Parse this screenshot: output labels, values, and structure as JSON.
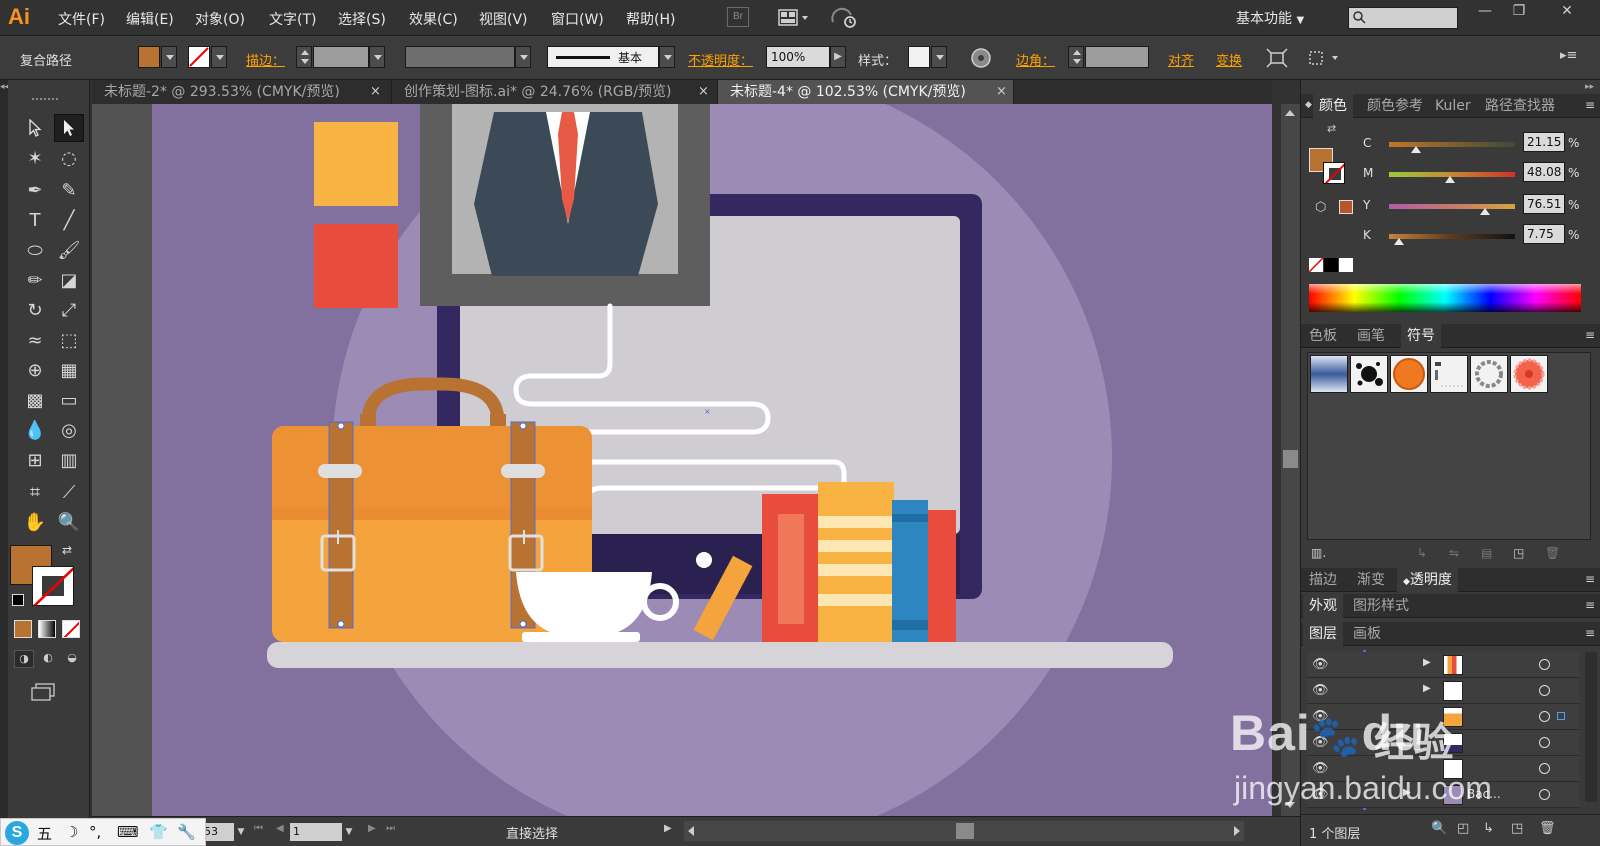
{
  "app": {
    "logo": "Ai"
  },
  "menu": {
    "items": [
      "文件(F)",
      "编辑(E)",
      "对象(O)",
      "文字(T)",
      "选择(S)",
      "效果(C)",
      "视图(V)",
      "窗口(W)",
      "帮助(H)"
    ],
    "bridge": "Br",
    "workspace": "基本功能",
    "window_min": "—",
    "window_restore": "❐",
    "window_close": "✕"
  },
  "control_bar": {
    "selection_type": "复合路径",
    "fill_color": "#b87333",
    "stroke_label": "描边：",
    "stroke_profile": "基本",
    "opacity_label": "不透明度：",
    "opacity_value": "100%",
    "style_label": "样式：",
    "corner_label": "边角：",
    "align_label": "对齐",
    "transform_label": "变换"
  },
  "tabs": [
    {
      "label": "未标题-2* @ 293.53% (CMYK/预览)",
      "close": "×",
      "active": false
    },
    {
      "label": "创作策划-图标.ai* @ 24.76% (RGB/预览)",
      "close": "×",
      "active": false
    },
    {
      "label": "未标题-4* @ 102.53% (CMYK/预览)",
      "close": "×",
      "active": true
    }
  ],
  "colors": {
    "canvas_bg": "#82719f",
    "circle": "#9b8bb5",
    "monitor_frame": "#332860",
    "monitor_screen": "#cfcdd1",
    "bag_body": "#f4a33d",
    "bag_lid": "#ec9235",
    "bag_handle": "#b87333",
    "strap": "#b87333",
    "shelf": "#d6d4d8",
    "accent_orange": "#f9b343",
    "accent_red": "#e74c3c",
    "book_blue": "#2e86c1",
    "suit": "#3c4a57"
  },
  "color_panel": {
    "tabs": [
      "颜色",
      "颜色参考",
      "Kuler",
      "路径查找器"
    ],
    "channels": [
      {
        "name": "C",
        "value": "21.15",
        "pct": 21.15
      },
      {
        "name": "M",
        "value": "48.08",
        "pct": 48.08
      },
      {
        "name": "Y",
        "value": "76.51",
        "pct": 76.51
      },
      {
        "name": "K",
        "value": "7.75",
        "pct": 7.75
      }
    ],
    "percent_sign": "%"
  },
  "swatch_panel": {
    "tabs": [
      "色板",
      "画笔",
      "符号"
    ]
  },
  "transparency_panel": {
    "tabs": [
      "描边",
      "渐变",
      "透明度"
    ]
  },
  "appearance_panel": {
    "tabs": [
      "外观",
      "图形样式"
    ]
  },
  "layers_panel": {
    "tabs": [
      "图层",
      "画板"
    ],
    "rows": [
      "",
      "",
      "",
      "",
      "",
      "Bac..."
    ],
    "footer": "1 个图层"
  },
  "status": {
    "zoom": "53",
    "artboard": "1",
    "tool": "直接选择"
  },
  "watermark": {
    "logo": "Bai",
    "logo_tail": "du",
    "jingyan": "经验",
    "url": "jingyan.baidu.com"
  },
  "ime": {
    "logo": "S",
    "items": [
      "五",
      "☽",
      "°,",
      "⌨",
      "👕",
      "🔧"
    ]
  }
}
